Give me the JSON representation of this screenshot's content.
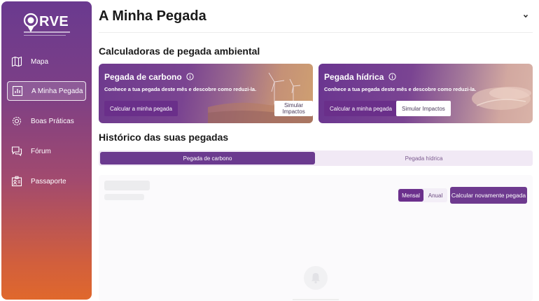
{
  "sidebar": {
    "logo_text": "RVE",
    "items": [
      {
        "label": "Mapa",
        "icon": "map-icon"
      },
      {
        "label": "A Minha Pegada",
        "icon": "chart-icon",
        "active": true
      },
      {
        "label": "Boas Práticas",
        "icon": "gear-icon"
      },
      {
        "label": "Fórum",
        "icon": "forum-icon"
      },
      {
        "label": "Passaporte",
        "icon": "passport-icon"
      }
    ]
  },
  "header": {
    "title": "A Minha Pegada",
    "chevron_icon": "chevron-down-icon"
  },
  "calculators": {
    "section_title": "Calculadoras de pegada ambiental",
    "cards": [
      {
        "title": "Pegada de carbono",
        "description": "Conhece a tua pegada deste mês e descobre como reduzi-la.",
        "primary_label": "Calcular a minha pegada",
        "secondary_label": "Simular Impactos"
      },
      {
        "title": "Pegada hídrica",
        "description": "Conhece a tua pegada deste mês e descobre como reduzi-la.",
        "primary_label": "Calcular a minha pegada",
        "secondary_label": "Simular Impactos"
      }
    ]
  },
  "history": {
    "section_title": "Histórico das suas pegadas",
    "tabs": [
      {
        "label": "Pegada de carbono",
        "active": true
      },
      {
        "label": "Pegada hídrica",
        "active": false
      }
    ],
    "period": {
      "monthly": "Mensal",
      "annual": "Anual",
      "selected": "Mensal"
    },
    "recalc_label": "Calcular novamente pegada"
  },
  "colors": {
    "accent": "#6b3a8f",
    "sidebar_top": "#6a3a8f",
    "sidebar_bottom": "#e0682c"
  }
}
